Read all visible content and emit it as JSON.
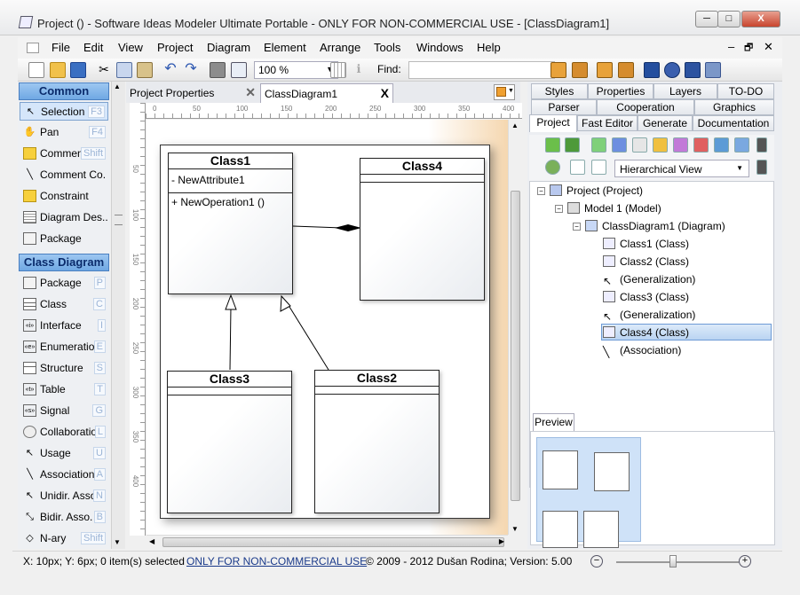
{
  "window": {
    "title": "Project ()  - Software Ideas Modeler Ultimate Portable - ONLY FOR NON-COMMERCIAL USE - [ClassDiagram1]",
    "minimize": "─",
    "maximize": "□",
    "close": "X"
  },
  "menu": {
    "items": [
      "File",
      "Edit",
      "View",
      "Project",
      "Diagram",
      "Element",
      "Arrange",
      "Tools",
      "Windows",
      "Help"
    ],
    "right_controls": [
      "–",
      "🗗",
      "✕"
    ]
  },
  "toolbar": {
    "zoom_value": "100 %",
    "find_label": "Find:",
    "find_value": ""
  },
  "toolbox": {
    "common_header": "Common",
    "common_items": [
      {
        "label": "Selection",
        "key": "F3",
        "icon": "cursor-icon"
      },
      {
        "label": "Pan",
        "key": "F4",
        "icon": "hand-icon"
      },
      {
        "label": "Comment",
        "key": "Shift",
        "icon": "comment-icon"
      },
      {
        "label": "Comment Co.",
        "key": "",
        "icon": "comment-connector-icon"
      },
      {
        "label": "Constraint",
        "key": "",
        "icon": "constraint-icon"
      },
      {
        "label": "Diagram Des...",
        "key": "",
        "icon": "diagram-description-icon"
      },
      {
        "label": "Package",
        "key": "",
        "icon": "package-icon"
      }
    ],
    "class_header": "Class Diagram",
    "class_items": [
      {
        "label": "Package",
        "key": "P",
        "icon": "package-icon"
      },
      {
        "label": "Class",
        "key": "C",
        "icon": "class-icon"
      },
      {
        "label": "Interface",
        "key": "I",
        "icon": "interface-icon"
      },
      {
        "label": "Enumeration",
        "key": "E",
        "icon": "enumeration-icon"
      },
      {
        "label": "Structure",
        "key": "S",
        "icon": "structure-icon"
      },
      {
        "label": "Table",
        "key": "T",
        "icon": "table-icon"
      },
      {
        "label": "Signal",
        "key": "G",
        "icon": "signal-icon"
      },
      {
        "label": "Collaboration",
        "key": "L",
        "icon": "collaboration-icon"
      },
      {
        "label": "Usage",
        "key": "U",
        "icon": "usage-icon"
      },
      {
        "label": "Association",
        "key": "A",
        "icon": "association-icon"
      },
      {
        "label": "Unidir. Asso.",
        "key": "N",
        "icon": "unidirectional-association-icon"
      },
      {
        "label": "Bidir. Asso.",
        "key": "B",
        "icon": "bidirectional-association-icon"
      },
      {
        "label": "N-ary",
        "key": "Shift",
        "icon": "nary-icon"
      }
    ]
  },
  "doc_tabs": [
    {
      "label": "Project Properties",
      "close": "✕"
    },
    {
      "label": "ClassDiagram1",
      "close": "X"
    }
  ],
  "ruler": {
    "h": [
      "0",
      "50",
      "100",
      "150",
      "200",
      "250",
      "300",
      "350",
      "400"
    ],
    "v": [
      "50",
      "100",
      "150",
      "200",
      "250",
      "300",
      "350",
      "400"
    ]
  },
  "diagram": {
    "classes": [
      {
        "name": "Class1",
        "attributes": [
          "- NewAttribute1"
        ],
        "operations": [
          "+ NewOperation1 ()"
        ]
      },
      {
        "name": "Class4",
        "attributes": [],
        "operations": []
      },
      {
        "name": "Class3",
        "attributes": [],
        "operations": []
      },
      {
        "name": "Class2",
        "attributes": [],
        "operations": []
      }
    ]
  },
  "right_panel": {
    "tabs_row1": [
      "Styles",
      "Properties",
      "Layers",
      "TO-DO"
    ],
    "tabs_row2": [
      "Parser",
      "Cooperation",
      "Graphics"
    ],
    "tabs_row3": [
      "Project",
      "Fast Editor",
      "Generate",
      "Documentation"
    ],
    "view_select": "Hierarchical View",
    "tree": [
      {
        "label": "Project (Project)",
        "level": 0
      },
      {
        "label": "Model 1 (Model)",
        "level": 1
      },
      {
        "label": "ClassDiagram1 (Diagram)",
        "level": 2
      },
      {
        "label": "Class1 (Class)",
        "level": 3
      },
      {
        "label": "Class2 (Class)",
        "level": 3
      },
      {
        "label": "(Generalization)",
        "level": 3
      },
      {
        "label": "Class3 (Class)",
        "level": 3
      },
      {
        "label": "(Generalization)",
        "level": 3
      },
      {
        "label": "Class4 (Class)",
        "level": 3
      },
      {
        "label": "(Association)",
        "level": 3
      }
    ],
    "preview_tab": "Preview"
  },
  "status": {
    "coords": "X: 10px; Y: 6px; 0 item(s) selected",
    "license": "ONLY FOR NON-COMMERCIAL USE",
    "copyright": "© 2009 - 2012 Dušan Rodina; Version: 5.00",
    "zoom_out": "−",
    "zoom_in": "+"
  }
}
